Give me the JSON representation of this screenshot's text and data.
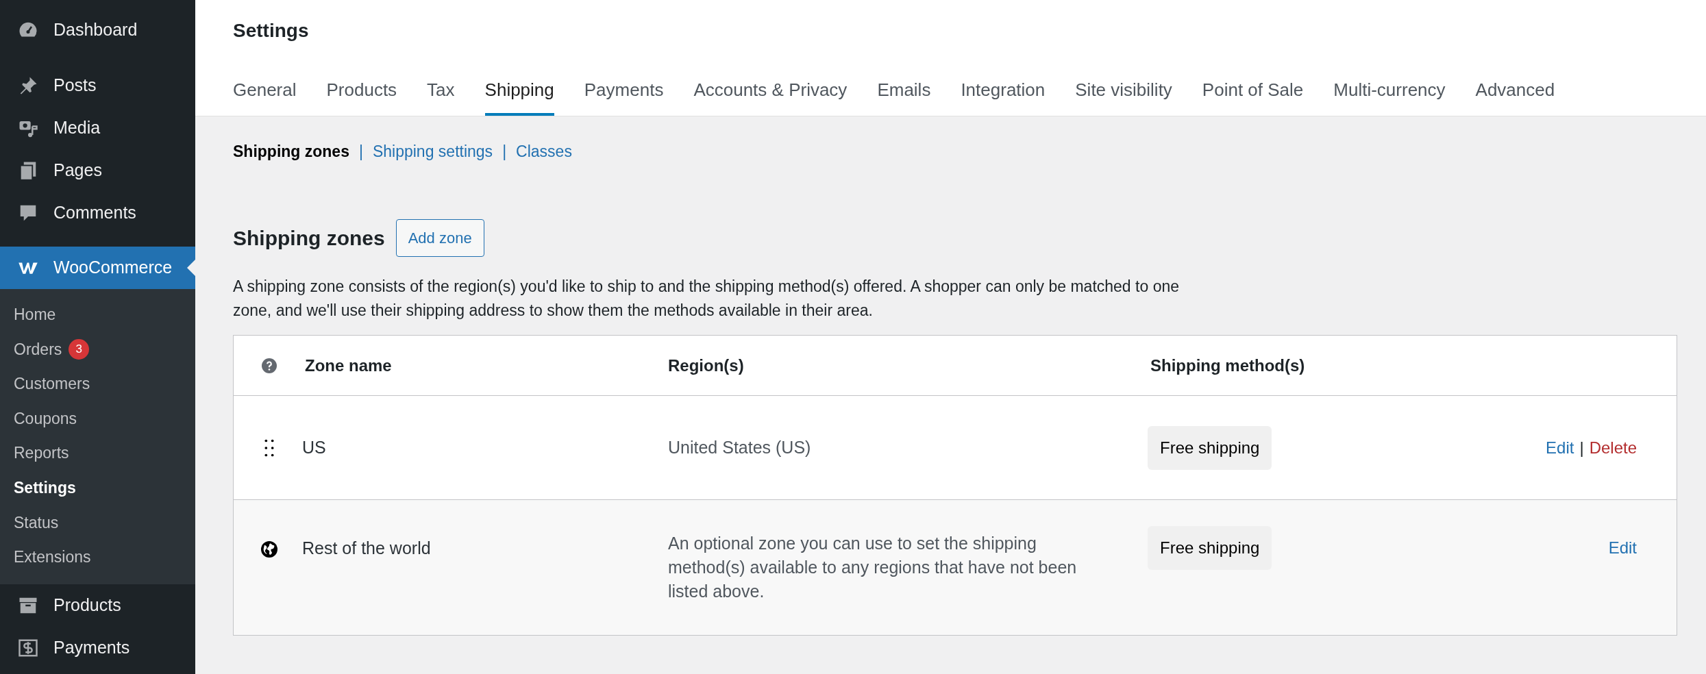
{
  "sidebar": {
    "items": [
      {
        "label": "Dashboard",
        "selected": false
      },
      {
        "label": "Posts",
        "selected": false
      },
      {
        "label": "Media",
        "selected": false
      },
      {
        "label": "Pages",
        "selected": false
      },
      {
        "label": "Comments",
        "selected": false
      },
      {
        "label": "WooCommerce",
        "selected": true,
        "children": [
          {
            "label": "Home",
            "selected": false
          },
          {
            "label": "Orders",
            "selected": false,
            "badge": "3"
          },
          {
            "label": "Customers",
            "selected": false
          },
          {
            "label": "Coupons",
            "selected": false
          },
          {
            "label": "Reports",
            "selected": false
          },
          {
            "label": "Settings",
            "selected": true
          },
          {
            "label": "Status",
            "selected": false
          },
          {
            "label": "Extensions",
            "selected": false
          }
        ]
      },
      {
        "label": "Products",
        "selected": false
      },
      {
        "label": "Payments",
        "selected": false
      }
    ]
  },
  "page_title": "Settings",
  "tabs": [
    {
      "label": "General",
      "selected": false
    },
    {
      "label": "Products",
      "selected": false
    },
    {
      "label": "Tax",
      "selected": false
    },
    {
      "label": "Shipping",
      "selected": true
    },
    {
      "label": "Payments",
      "selected": false
    },
    {
      "label": "Accounts & Privacy",
      "selected": false
    },
    {
      "label": "Emails",
      "selected": false
    },
    {
      "label": "Integration",
      "selected": false
    },
    {
      "label": "Site visibility",
      "selected": false
    },
    {
      "label": "Point of Sale",
      "selected": false
    },
    {
      "label": "Multi-currency",
      "selected": false
    },
    {
      "label": "Advanced",
      "selected": false
    }
  ],
  "subnav": [
    {
      "label": "Shipping zones",
      "selected": true
    },
    {
      "separator": "|",
      "label": "Shipping settings",
      "selected": false
    },
    {
      "separator": "|",
      "label": "Classes",
      "selected": false
    }
  ],
  "section": {
    "heading": "Shipping zones",
    "button": "Add zone",
    "description": "A shipping zone consists of the region(s) you'd like to ship to and the shipping method(s) offered. A shopper can only be matched to one zone, and we'll use their shipping address to show them the methods available in their area."
  },
  "table": {
    "columns": [
      "Zone name",
      "Region(s)",
      "Shipping method(s)"
    ],
    "rows": [
      {
        "kind": "zone",
        "name": "US",
        "region": "United States (US)",
        "methods": [
          "Free shipping"
        ],
        "actions": [
          {
            "kind": "edit",
            "label": "Edit"
          },
          {
            "kind": "delete",
            "separator": "|",
            "label": "Delete"
          }
        ]
      },
      {
        "kind": "rest",
        "name": "Rest of the world",
        "region": "An optional zone you can use to set the shipping method(s) available to any regions that have not been listed above.",
        "methods": [
          "Free shipping"
        ],
        "actions": [
          {
            "kind": "edit",
            "label": "Edit"
          }
        ]
      }
    ]
  }
}
